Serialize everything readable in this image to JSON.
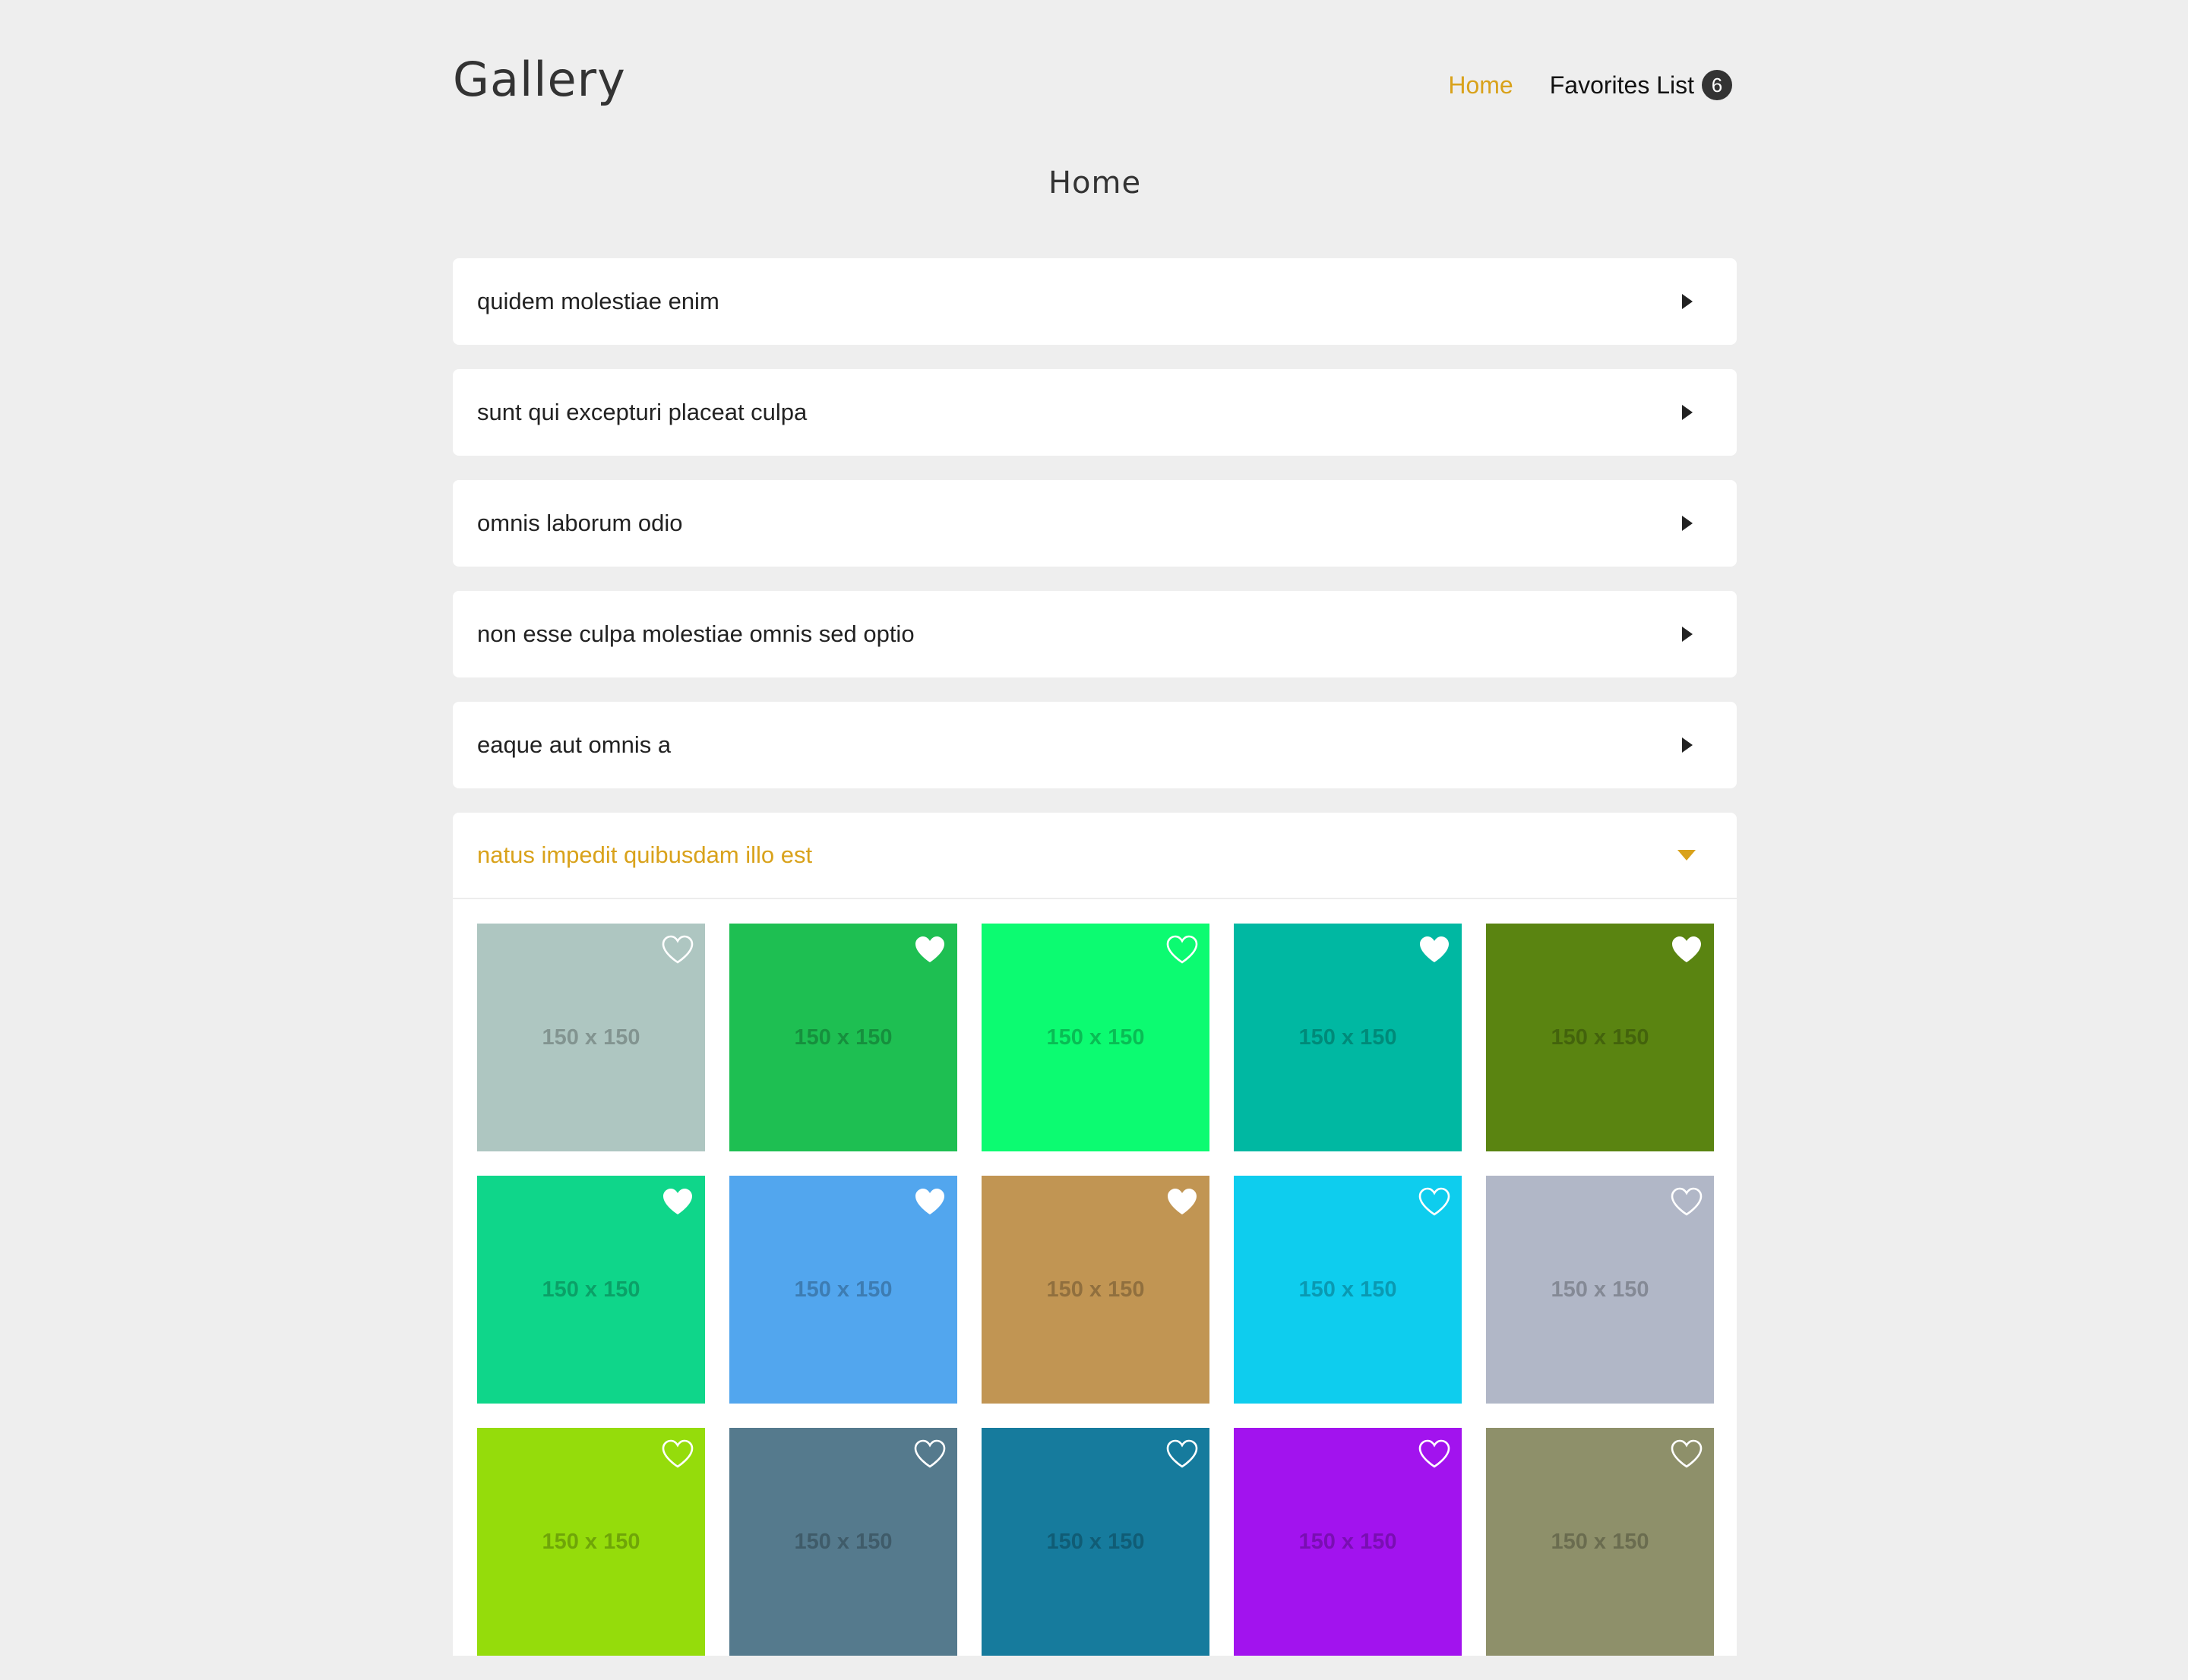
{
  "header": {
    "logo": "Gallery",
    "nav": {
      "home": "Home",
      "favorites": "Favorites List",
      "favorites_count": "6"
    }
  },
  "page_title": "Home",
  "accordion": [
    {
      "title": "quidem molestiae enim"
    },
    {
      "title": "sunt qui excepturi placeat culpa"
    },
    {
      "title": "omnis laborum odio"
    },
    {
      "title": "non esse culpa molestiae omnis sed optio"
    },
    {
      "title": "eaque aut omnis a"
    },
    {
      "title": "natus impedit quibusdam illo est"
    }
  ],
  "open_album": {
    "photos": [
      {
        "label": "150 x 150",
        "color": "#aec6c1",
        "favorite": false
      },
      {
        "label": "150 x 150",
        "color": "#1ebf52",
        "favorite": true
      },
      {
        "label": "150 x 150",
        "color": "#0cfb71",
        "favorite": false
      },
      {
        "label": "150 x 150",
        "color": "#00b8a2",
        "favorite": true
      },
      {
        "label": "150 x 150",
        "color": "#5a8411",
        "favorite": true
      },
      {
        "label": "150 x 150",
        "color": "#0fd68a",
        "favorite": true
      },
      {
        "label": "150 x 150",
        "color": "#52a6ee",
        "favorite": true
      },
      {
        "label": "150 x 150",
        "color": "#c19553",
        "favorite": true
      },
      {
        "label": "150 x 150",
        "color": "#0ecdee",
        "favorite": false
      },
      {
        "label": "150 x 150",
        "color": "#b1b7c7",
        "favorite": false
      },
      {
        "label": "150 x 150",
        "color": "#95dc0b",
        "favorite": false
      },
      {
        "label": "150 x 150",
        "color": "#557a8d",
        "favorite": false
      },
      {
        "label": "150 x 150",
        "color": "#167b9d",
        "favorite": false
      },
      {
        "label": "150 x 150",
        "color": "#a213ee",
        "favorite": false
      },
      {
        "label": "150 x 150",
        "color": "#8e906a",
        "favorite": false
      }
    ]
  },
  "colors": {
    "accent": "#d9a21b",
    "background": "#eeeeee",
    "card": "#ffffff"
  },
  "icons": {
    "collapsed": "triangle-right-icon",
    "expanded": "triangle-down-icon",
    "favorite_on": "heart-filled-icon",
    "favorite_off": "heart-outline-icon"
  }
}
